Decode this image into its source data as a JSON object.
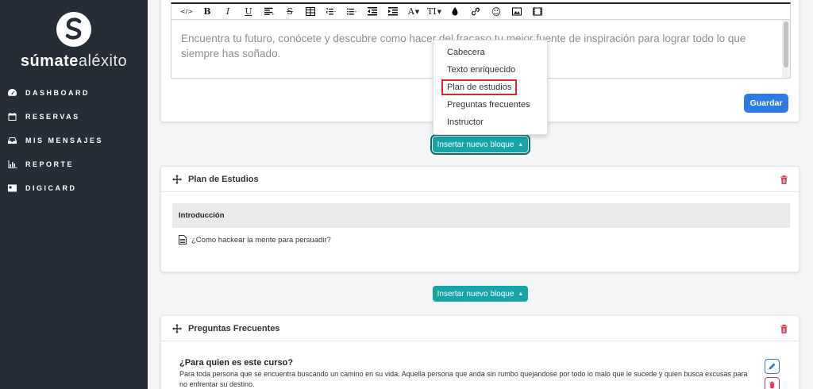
{
  "brand": {
    "name_bold": "súmate",
    "name_thin": "aléxito"
  },
  "sidebar": {
    "items": [
      {
        "label": "DASHBOARD",
        "icon": "dashboard-icon"
      },
      {
        "label": "RESERVAS",
        "icon": "calendar-icon"
      },
      {
        "label": "MIS MENSAJES",
        "icon": "inbox-icon"
      },
      {
        "label": "REPORTE",
        "icon": "bar-chart-icon"
      },
      {
        "label": "DIGICARD",
        "icon": "id-card-icon"
      }
    ]
  },
  "editor": {
    "toolbar": [
      "</>",
      "B",
      "I",
      "U",
      "align",
      "S",
      "table",
      "ordered-list",
      "unordered-list",
      "outdent",
      "indent",
      "A",
      "TI",
      "ink",
      "link",
      "emoji",
      "image",
      "video"
    ],
    "text": "Encuentra tu futuro, conócete y descubre como hacer del fracaso tu mejor fuente de inspiración para lograr todo lo que siempre has soñado.",
    "save_label": "Guardar"
  },
  "insert_block_label": "Insertar nuevo bloque",
  "dropdown": {
    "items": [
      "Cabecera",
      "Texto enriquecido",
      "Plan de estudios",
      "Preguntas frecuentes",
      "Instructor"
    ],
    "highlighted": "Plan de estudios"
  },
  "plan": {
    "title": "Plan de Estudios",
    "section": "Introducción",
    "lesson": "¿Como hackear la mente para persuadir?"
  },
  "faq": {
    "title": "Preguntas Frecuentes",
    "question": "¿Para quien es este curso?",
    "answer": "Para toda persona que se encuentra buscando un camino en su vida. Aquella persona que anda sin rumbo quejándose por todo lo malo que le sucede y quien busca excusas para no enfrentar su destino."
  },
  "colors": {
    "sidebar": "#262d37",
    "primary": "#2c7be5",
    "teal": "#16a4a8",
    "danger": "#e63757"
  }
}
